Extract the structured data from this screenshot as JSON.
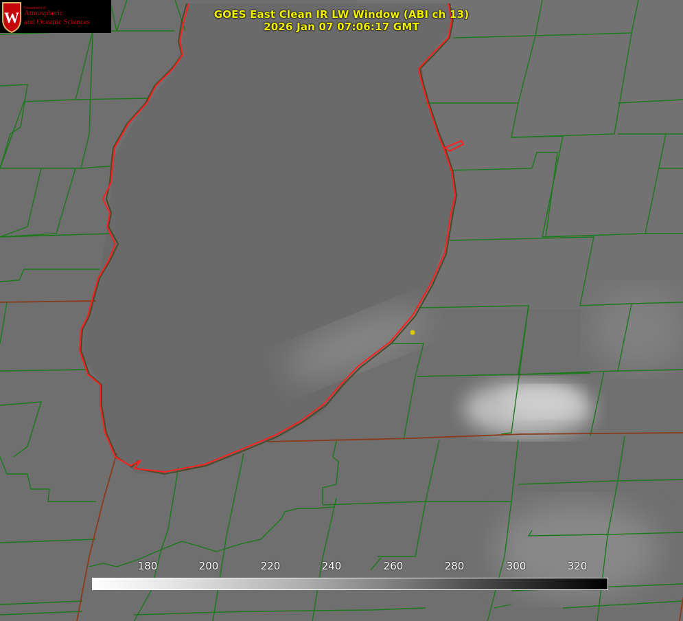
{
  "logo": {
    "dept": "Department of",
    "line1": "Atmospheric",
    "line2": "and Oceanic Sciences",
    "shield_letter": "W"
  },
  "title": {
    "line1": "GOES East Clean IR LW Window (ABI ch 13)",
    "line2": "2026 Jan 07 07:06:17 GMT"
  },
  "colorbar": {
    "ticks": [
      "180",
      "200",
      "220",
      "240",
      "260",
      "280",
      "300",
      "320"
    ]
  },
  "colors": {
    "county_lines": "#1a7a1a",
    "shoreline": "#ff2020",
    "station_dot": "#d8c800",
    "title": "#f0f000"
  }
}
